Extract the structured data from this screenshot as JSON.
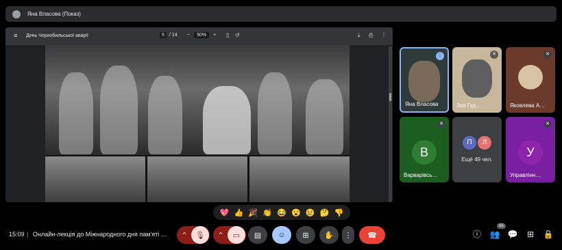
{
  "presenter": {
    "label": "Яна Власова (Показ)"
  },
  "pdf": {
    "title": "День Чорнобильської аварії",
    "page_current": "5",
    "page_total": "/ 14",
    "zoom": "50%"
  },
  "participants": [
    {
      "name": "Яна Власова",
      "mic": "speaking"
    },
    {
      "name": "Зоя Гуд…",
      "mic": "muted"
    },
    {
      "name": "Яковлева А…",
      "mic": "muted"
    },
    {
      "name": "Варварівсь…",
      "initial": "В",
      "mic": "muted",
      "color": "#2e7d32"
    },
    {
      "more_label": "Ещё 49 чел.",
      "initials": [
        "П",
        "Л"
      ]
    },
    {
      "name": "Управлінн…",
      "initial": "У",
      "mic": "muted",
      "color": "#8e24aa"
    }
  ],
  "reactions": [
    "💖",
    "👍",
    "🎉",
    "👏",
    "😂",
    "😮",
    "😢",
    "🤔",
    "👎"
  ],
  "bottom": {
    "time": "15:09",
    "separator": "|",
    "meeting_title": "Онлайн-лекція до Міжнародного дня пам'яті …",
    "people_count": "55"
  },
  "colors": {
    "mic_off_bg": "#f9dedc",
    "end_call": "#ea4335",
    "reaction_active": "#a8c7fa"
  }
}
